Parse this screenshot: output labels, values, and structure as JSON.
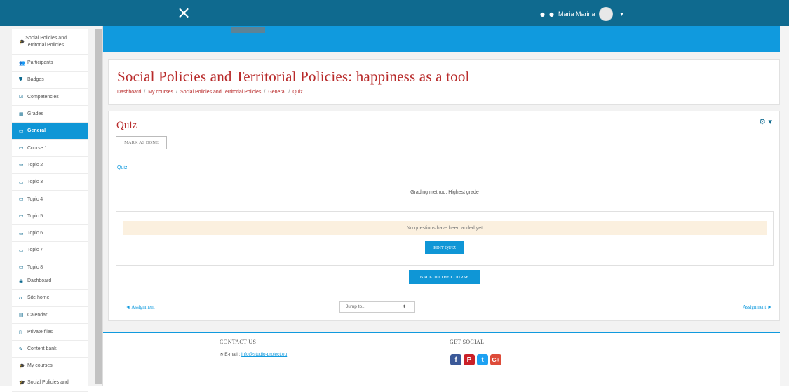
{
  "topbar": {
    "close_icon": "×",
    "bell_icon": "●",
    "chat_icon": "●",
    "user_name": "Maria Marina",
    "caret": "▾"
  },
  "drawer": {
    "items": [
      {
        "icon": "🎓",
        "label": "Social Policies and Territorial Policies"
      },
      {
        "icon": "👥",
        "label": "Participants"
      },
      {
        "icon": "⛊",
        "label": "Badges"
      },
      {
        "icon": "☑",
        "label": "Competencies"
      },
      {
        "icon": "▦",
        "label": "Grades"
      },
      {
        "icon": "▭",
        "label": "General"
      },
      {
        "icon": "▭",
        "label": "Course 1"
      },
      {
        "icon": "▭",
        "label": "Topic 2"
      },
      {
        "icon": "▭",
        "label": "Topic 3"
      },
      {
        "icon": "▭",
        "label": "Topic 4"
      },
      {
        "icon": "▭",
        "label": "Topic 5"
      },
      {
        "icon": "▭",
        "label": "Topic 6"
      },
      {
        "icon": "▭",
        "label": "Topic 7"
      },
      {
        "icon": "▭",
        "label": "Topic 8"
      },
      {
        "icon": "◉",
        "label": "Dashboard"
      },
      {
        "icon": "⌂",
        "label": "Site home"
      },
      {
        "icon": "▤",
        "label": "Calendar"
      },
      {
        "icon": "▯",
        "label": "Private files"
      },
      {
        "icon": "✎",
        "label": "Content bank"
      },
      {
        "icon": "🎓",
        "label": "My courses"
      },
      {
        "icon": "🎓",
        "label": "Social Policies and"
      }
    ]
  },
  "header": {
    "title": "Social Policies and Territorial Policies: happiness as a tool",
    "breadcrumb": [
      "Dashboard",
      "My courses",
      "Social Policies and Territorial Policies",
      "General",
      "Quiz"
    ]
  },
  "main": {
    "quiz_title": "Quiz",
    "gear_icon": "⚙ ▾",
    "mark_done": "MARK AS DONE",
    "quiz_link": "Quiz",
    "grading": "Grading method: Highest grade",
    "notice": "No questions have been added yet",
    "edit_quiz": "EDIT QUIZ",
    "back_to_course": "BACK TO THE COURSE",
    "prev": "◄ Assignment",
    "next": "Assignment ►",
    "jump_to": "Jump to...",
    "jump_caret": "⬍"
  },
  "footer": {
    "contact_heading": "CONTACT US",
    "email_label": "✉ E-mail : ",
    "email": "info@studio-project.eu",
    "social_heading": "GET SOCIAL",
    "social": [
      {
        "name": "facebook",
        "glyph": "f",
        "color": "#3b5998"
      },
      {
        "name": "pinterest",
        "glyph": "P",
        "color": "#cb2027"
      },
      {
        "name": "twitter",
        "glyph": "t",
        "color": "#1da1f2"
      },
      {
        "name": "google-plus",
        "glyph": "G+",
        "color": "#dd4b39"
      }
    ]
  }
}
